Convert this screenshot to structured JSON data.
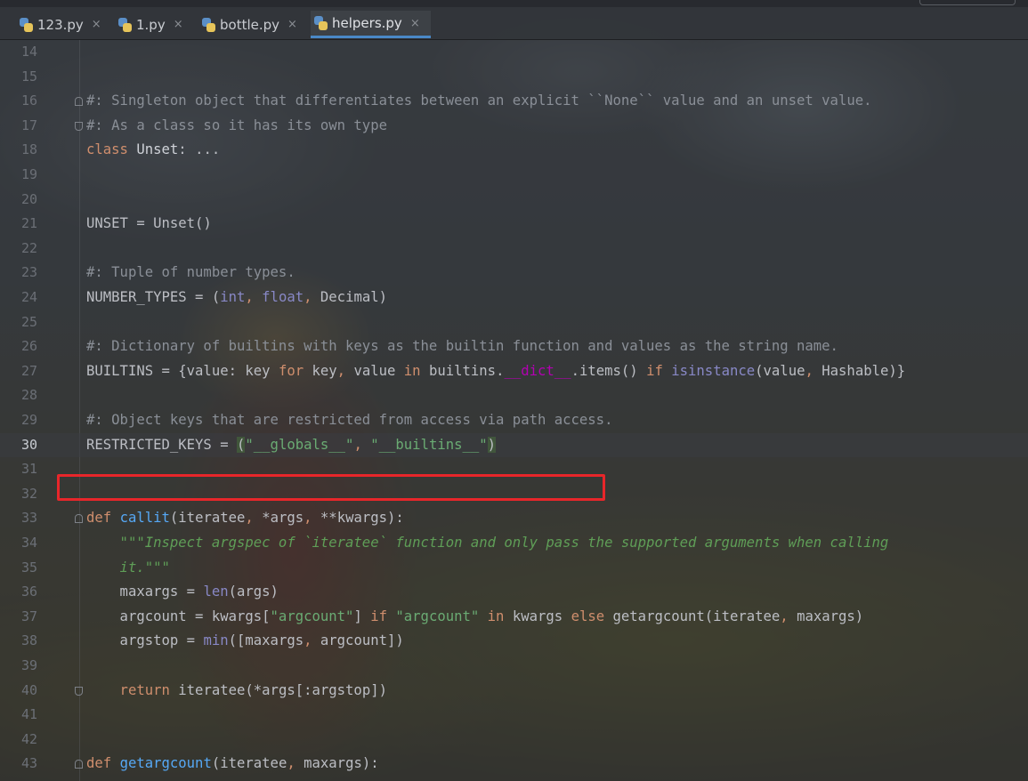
{
  "tabs": [
    {
      "label": "123.py",
      "active": false
    },
    {
      "label": "1.py",
      "active": false
    },
    {
      "label": "bottle.py",
      "active": false
    },
    {
      "label": "helpers.py",
      "active": true
    }
  ],
  "tab_close_glyph": "×",
  "editor": {
    "current_line": 30,
    "lines": [
      {
        "n": "14",
        "tokens": []
      },
      {
        "n": "15",
        "tokens": []
      },
      {
        "n": "16",
        "fold": "start",
        "tokens": [
          {
            "t": "#: Singleton object that differentiates between an explicit ``None`` value and an unset value.",
            "c": "cm"
          }
        ]
      },
      {
        "n": "17",
        "fold": "end",
        "tokens": [
          {
            "t": "#: As a class so it has its own type",
            "c": "cm"
          }
        ]
      },
      {
        "n": "18",
        "tokens": [
          {
            "t": "class ",
            "c": "kw"
          },
          {
            "t": "Unset",
            "c": "def"
          },
          {
            "t": ": ...",
            "c": "plain"
          }
        ]
      },
      {
        "n": "19",
        "tokens": []
      },
      {
        "n": "20",
        "tokens": []
      },
      {
        "n": "21",
        "tokens": [
          {
            "t": "UNSET = Unset()",
            "c": "plain"
          }
        ]
      },
      {
        "n": "22",
        "tokens": []
      },
      {
        "n": "23",
        "tokens": [
          {
            "t": "#: Tuple of number types.",
            "c": "cm"
          }
        ]
      },
      {
        "n": "24",
        "tokens": [
          {
            "t": "NUMBER_TYPES = (",
            "c": "plain"
          },
          {
            "t": "int",
            "c": "bi"
          },
          {
            "t": ", ",
            "c": "kw"
          },
          {
            "t": "float",
            "c": "bi"
          },
          {
            "t": ", ",
            "c": "kw"
          },
          {
            "t": "Decimal)",
            "c": "plain"
          }
        ]
      },
      {
        "n": "25",
        "tokens": []
      },
      {
        "n": "26",
        "tokens": [
          {
            "t": "#: Dictionary of builtins with keys as the builtin function and values as the string name.",
            "c": "cm"
          }
        ]
      },
      {
        "n": "27",
        "tokens": [
          {
            "t": "BUILTINS = {value: key ",
            "c": "plain"
          },
          {
            "t": "for ",
            "c": "kw"
          },
          {
            "t": "key",
            "c": "plain"
          },
          {
            "t": ", ",
            "c": "kw"
          },
          {
            "t": "value ",
            "c": "plain"
          },
          {
            "t": "in ",
            "c": "kw"
          },
          {
            "t": "builtins.",
            "c": "plain"
          },
          {
            "t": "__dict__",
            "c": "dund"
          },
          {
            "t": ".items() ",
            "c": "plain"
          },
          {
            "t": "if ",
            "c": "kw"
          },
          {
            "t": "isinstance",
            "c": "bi"
          },
          {
            "t": "(value",
            "c": "plain"
          },
          {
            "t": ", ",
            "c": "kw"
          },
          {
            "t": "Hashable)}",
            "c": "plain"
          }
        ]
      },
      {
        "n": "28",
        "tokens": []
      },
      {
        "n": "29",
        "tokens": [
          {
            "t": "#: Object keys that are restricted from access via path access.",
            "c": "cm"
          }
        ]
      },
      {
        "n": "30",
        "tokens": [
          {
            "t": "RESTRICTED_KEYS = ",
            "c": "plain"
          },
          {
            "t": "(",
            "c": "brk"
          },
          {
            "t": "\"__globals__\"",
            "c": "str"
          },
          {
            "t": ", ",
            "c": "kw"
          },
          {
            "t": "\"__builtins__\"",
            "c": "str"
          },
          {
            "t": ")",
            "c": "brk"
          }
        ]
      },
      {
        "n": "31",
        "tokens": []
      },
      {
        "n": "32",
        "tokens": []
      },
      {
        "n": "33",
        "fold": "start",
        "tokens": [
          {
            "t": "def ",
            "c": "kw"
          },
          {
            "t": "callit",
            "c": "fn"
          },
          {
            "t": "(iteratee",
            "c": "plain"
          },
          {
            "t": ", ",
            "c": "kw"
          },
          {
            "t": "*args",
            "c": "plain"
          },
          {
            "t": ", ",
            "c": "kw"
          },
          {
            "t": "**kwargs):",
            "c": "plain"
          }
        ]
      },
      {
        "n": "34",
        "tokens": [
          {
            "t": "    \"\"\"Inspect argspec of `iteratee` function and only pass the supported arguments when calling",
            "c": "doc"
          }
        ]
      },
      {
        "n": "35",
        "tokens": [
          {
            "t": "    it.\"\"\"",
            "c": "doc"
          }
        ]
      },
      {
        "n": "36",
        "tokens": [
          {
            "t": "    maxargs = ",
            "c": "plain"
          },
          {
            "t": "len",
            "c": "bi"
          },
          {
            "t": "(args)",
            "c": "plain"
          }
        ]
      },
      {
        "n": "37",
        "tokens": [
          {
            "t": "    argcount = kwargs[",
            "c": "plain"
          },
          {
            "t": "\"argcount\"",
            "c": "str"
          },
          {
            "t": "] ",
            "c": "plain"
          },
          {
            "t": "if ",
            "c": "kw"
          },
          {
            "t": "\"argcount\" ",
            "c": "str"
          },
          {
            "t": "in ",
            "c": "kw"
          },
          {
            "t": "kwargs ",
            "c": "plain"
          },
          {
            "t": "else ",
            "c": "kw"
          },
          {
            "t": "getargcount(iteratee",
            "c": "plain"
          },
          {
            "t": ", ",
            "c": "kw"
          },
          {
            "t": "maxargs)",
            "c": "plain"
          }
        ]
      },
      {
        "n": "38",
        "tokens": [
          {
            "t": "    argstop = ",
            "c": "plain"
          },
          {
            "t": "min",
            "c": "bi"
          },
          {
            "t": "([maxargs",
            "c": "plain"
          },
          {
            "t": ", ",
            "c": "kw"
          },
          {
            "t": "argcount])",
            "c": "plain"
          }
        ]
      },
      {
        "n": "39",
        "tokens": []
      },
      {
        "n": "40",
        "fold": "end",
        "tokens": [
          {
            "t": "    return ",
            "c": "kw"
          },
          {
            "t": "iteratee(*args[:argstop])",
            "c": "plain"
          }
        ]
      },
      {
        "n": "41",
        "tokens": []
      },
      {
        "n": "42",
        "tokens": []
      },
      {
        "n": "43",
        "fold": "start",
        "tokens": [
          {
            "t": "def ",
            "c": "kw"
          },
          {
            "t": "getargcount",
            "c": "fn"
          },
          {
            "t": "(iteratee",
            "c": "plain"
          },
          {
            "t": ", ",
            "c": "kw"
          },
          {
            "t": "maxargs):",
            "c": "plain"
          }
        ]
      }
    ]
  }
}
